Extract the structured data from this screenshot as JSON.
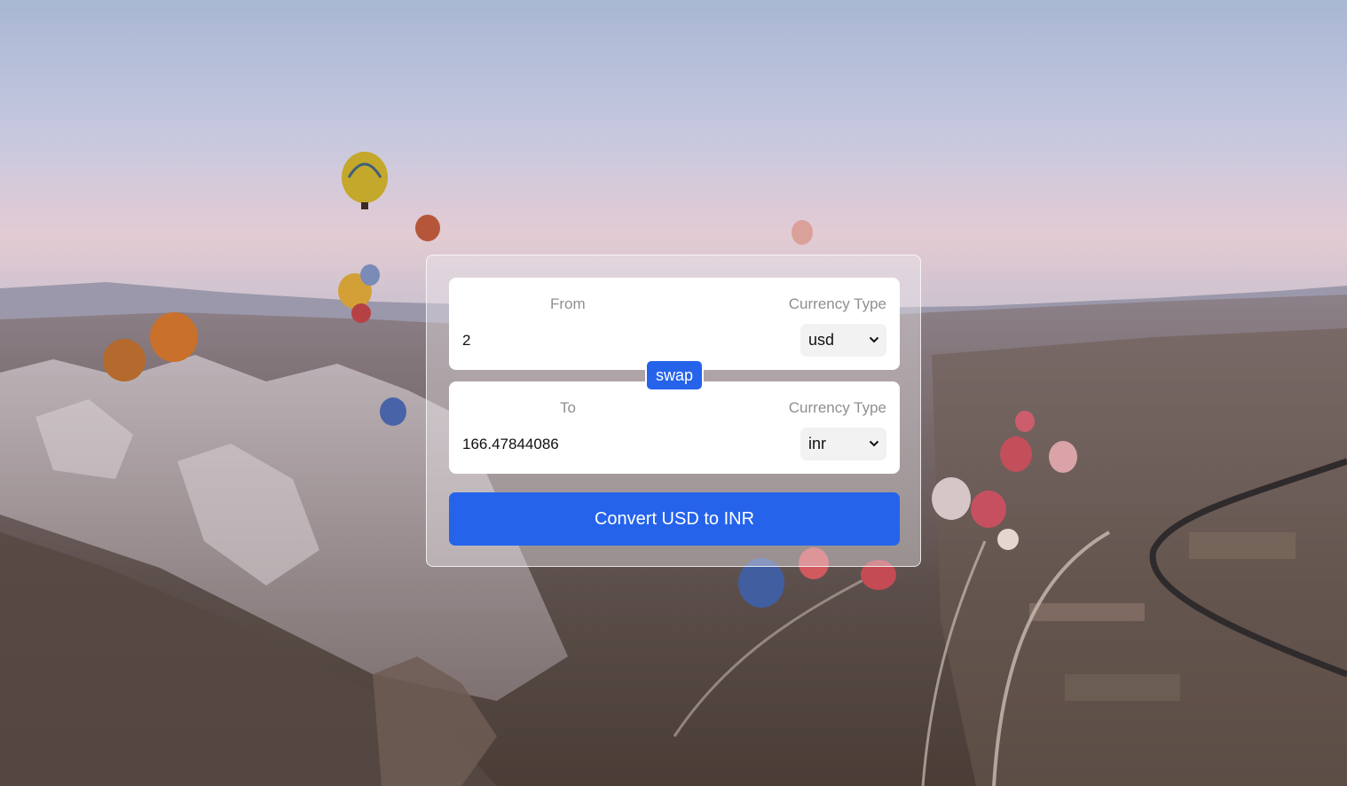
{
  "converter": {
    "from": {
      "label": "From",
      "currency_label": "Currency Type",
      "amount": "2",
      "currency": "usd"
    },
    "to": {
      "label": "To",
      "currency_label": "Currency Type",
      "amount": "166.47844086",
      "currency": "inr"
    },
    "swap_label": "swap",
    "convert_label": "Convert USD to INR"
  },
  "colors": {
    "accent": "#2563eb",
    "panel": "#ffffff",
    "label": "#8f8f8f"
  },
  "icons": {
    "select_arrow": "chevron-down-icon"
  }
}
